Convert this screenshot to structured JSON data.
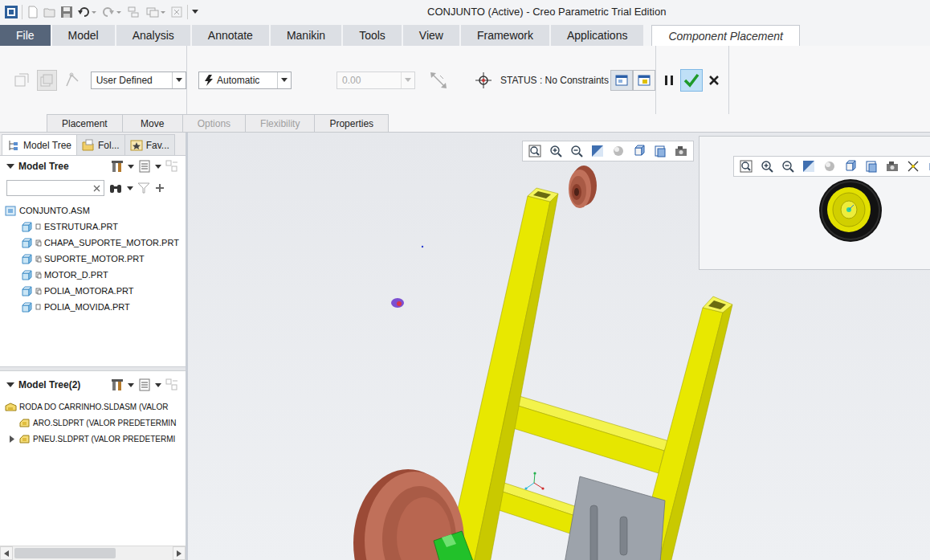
{
  "window": {
    "title": "CONJUNTO (Active) - Creo Parametric Trial Edition"
  },
  "ribbon_tabs": [
    {
      "label": "File",
      "selected": false,
      "kind": "file"
    },
    {
      "label": "Model",
      "selected": false,
      "kind": "tab"
    },
    {
      "label": "Analysis",
      "selected": false,
      "kind": "tab"
    },
    {
      "label": "Annotate",
      "selected": false,
      "kind": "tab"
    },
    {
      "label": "Manikin",
      "selected": false,
      "kind": "tab"
    },
    {
      "label": "Tools",
      "selected": false,
      "kind": "tab"
    },
    {
      "label": "View",
      "selected": false,
      "kind": "tab"
    },
    {
      "label": "Framework",
      "selected": false,
      "kind": "tab"
    },
    {
      "label": "Applications",
      "selected": false,
      "kind": "tab"
    },
    {
      "label": "Component Placement",
      "selected": true,
      "kind": "contextual"
    }
  ],
  "placement": {
    "constraint_set": "User Defined",
    "constraint_type": "Automatic",
    "offset": {
      "value": "0.00",
      "disabled": true
    },
    "status": "STATUS : No Constraints",
    "confirm_highlighted": true
  },
  "sub_tabs": [
    {
      "label": "Placement",
      "disabled": false
    },
    {
      "label": "Move",
      "disabled": false
    },
    {
      "label": "Options",
      "disabled": true
    },
    {
      "label": "Flexibility",
      "disabled": true
    },
    {
      "label": "Properties",
      "disabled": false
    }
  ],
  "side_tabs": [
    {
      "label": "Model Tree",
      "selected": true
    },
    {
      "label": "Fol...",
      "selected": false
    },
    {
      "label": "Fav...",
      "selected": false
    }
  ],
  "model_tree": {
    "title": "Model Tree",
    "items": [
      {
        "label": "CONJUNTO.ASM",
        "kind": "assembly",
        "depth": 0,
        "linked": false
      },
      {
        "label": "ESTRUTURA.PRT",
        "kind": "part",
        "depth": 1,
        "linked": false
      },
      {
        "label": "CHAPA_SUPORTE_MOTOR.PRT",
        "kind": "part",
        "depth": 1,
        "linked": true
      },
      {
        "label": "SUPORTE_MOTOR.PRT",
        "kind": "part",
        "depth": 1,
        "linked": true
      },
      {
        "label": "MOTOR_D.PRT",
        "kind": "part",
        "depth": 1,
        "linked": true
      },
      {
        "label": "POLIA_MOTORA.PRT",
        "kind": "part",
        "depth": 1,
        "linked": true
      },
      {
        "label": "POLIA_MOVIDA.PRT",
        "kind": "part",
        "depth": 1,
        "linked": false
      }
    ]
  },
  "model_tree_2": {
    "title": "Model Tree(2)",
    "items": [
      {
        "label": "RODA DO CARRINHO.SLDASM (VALOR",
        "kind": "sw-assembly",
        "depth": 0,
        "expandable": false,
        "expanded": false
      },
      {
        "label": "ARO.SLDPRT (VALOR PREDETERMIN",
        "kind": "sw-part",
        "depth": 1,
        "expandable": false,
        "expanded": false
      },
      {
        "label": "PNEU.SLDPRT (VALOR PREDETERMI",
        "kind": "sw-part",
        "depth": 1,
        "expandable": true,
        "expanded": false
      }
    ]
  }
}
